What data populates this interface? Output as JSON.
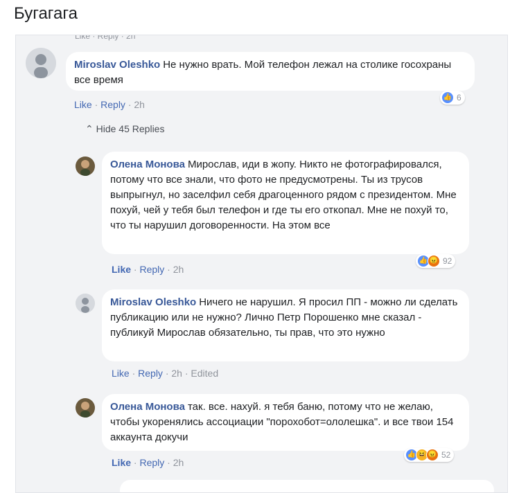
{
  "post_title": "Бугагага",
  "comments": [
    {
      "author": "Miroslav Oleshko",
      "text": "Не нужно врать. Мой телефон лежал на столике госохраны все время",
      "like": "Like",
      "reply": "Reply",
      "time": "2h",
      "reactions_count": "6"
    },
    {
      "author": "Олена Монова",
      "text": "Мирослав, иди в жопу. Никто не фотографировался, потому что все знали, что фото не предусмотрены. Ты из трусов выпрыгнул, но заселфил себя драгоценного рядом с президентом. Мне похуй, чей у тебя был телефон и где ты его откопал. Мне не похуй то, что ты нарушил договоренности. На этом все",
      "like": "Like",
      "reply": "Reply",
      "time": "2h",
      "reactions_count": "92"
    },
    {
      "author": "Miroslav Oleshko",
      "text": "Ничего не нарушил. Я просил ПП - можно ли сделать публикацию или не нужно? Лично Петр Порошенко мне сказал - публикуй Мирослав обязательно, ты прав, что это нужно",
      "like": "Like",
      "reply": "Reply",
      "time": "2h",
      "edited": "Edited"
    },
    {
      "author": "Олена Монова",
      "text": "так. все. нахуй. я тебя баню, потому что не желаю, чтобы укоренялись ассоциации \"порохобот=ололешка\". и все твои 154 аккаунта докучи",
      "like": "Like",
      "reply": "Reply",
      "time": "2h",
      "reactions_count": "52"
    }
  ],
  "hide_replies": "Hide 45 Replies",
  "colors": {
    "author": "#385898",
    "like_blue": "#4267b2",
    "panel_bg": "#f2f3f5"
  }
}
